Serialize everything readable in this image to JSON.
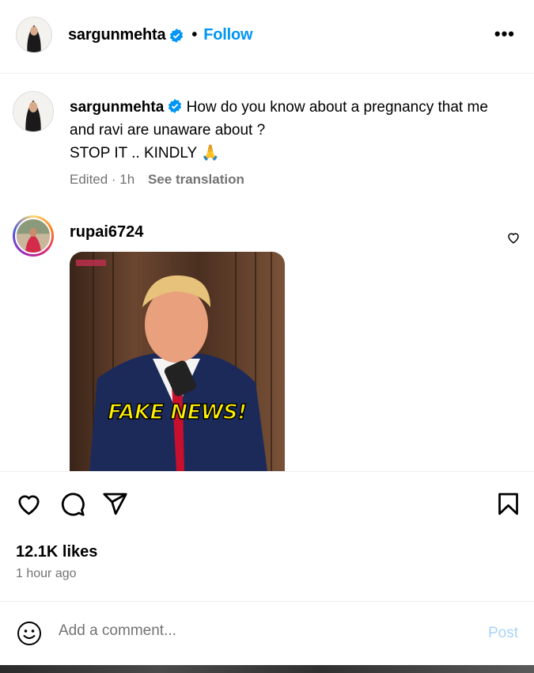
{
  "header": {
    "username": "sargunmehta",
    "separator": "•",
    "follow_label": "Follow",
    "more_label": "•••"
  },
  "caption": {
    "username": "sargunmehta",
    "text": "How do you know about a pregnancy that me and ravi are unaware about ?",
    "text_line2": "STOP IT .. KINDLY 🙏",
    "meta": "Edited · 1h",
    "see_translation": "See translation"
  },
  "comment": {
    "username": "rupai6724",
    "gif_text": "FAKE NEWS!"
  },
  "post": {
    "likes": "12.1K likes",
    "time": "1 hour ago"
  },
  "comment_bar": {
    "placeholder": "Add a comment...",
    "post_label": "Post"
  },
  "colors": {
    "accent": "#0095f6",
    "verified": "#0095f6",
    "post_disabled": "#a8d4f9",
    "muted": "#737373"
  },
  "icons": [
    "verified-icon",
    "more-options-icon",
    "heart-icon",
    "comment-icon",
    "share-icon",
    "bookmark-icon",
    "emoji-icon",
    "small-heart-icon"
  ]
}
